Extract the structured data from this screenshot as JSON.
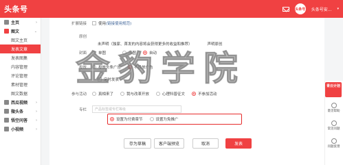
{
  "header": {
    "logo": "头条号",
    "avatar_text": "头条号",
    "user_name": "头条号安...",
    "caret": "▾"
  },
  "sidebar": {
    "items": [
      {
        "label": "主页",
        "type": "main",
        "caret": "›"
      },
      {
        "label": "图文",
        "type": "main",
        "caret": "⌄"
      },
      {
        "label": "图文主页",
        "type": "sub"
      },
      {
        "label": "发表文章",
        "type": "sub",
        "active": true
      },
      {
        "label": "发表图集",
        "type": "sub"
      },
      {
        "label": "内容管理",
        "type": "sub"
      },
      {
        "label": "评论管理",
        "type": "sub"
      },
      {
        "label": "素材管理",
        "type": "sub"
      },
      {
        "label": "图文数据",
        "type": "sub"
      },
      {
        "label": "西瓜视频",
        "type": "main",
        "caret": "›"
      },
      {
        "label": "微头条",
        "type": "main",
        "caret": "›"
      },
      {
        "label": "悟空问答",
        "type": "main",
        "caret": "›"
      },
      {
        "label": "小视频",
        "type": "main",
        "caret": "›"
      }
    ]
  },
  "form": {
    "extend_link": {
      "label": "扩展链接",
      "option": "使用",
      "link": "(链接使用规范)"
    },
    "original": {
      "label": "原创",
      "opt1": "未声明（独家、首发的内容将会获得更多的收益和推荐）",
      "opt2": "声明原创"
    },
    "cover": {
      "label": "封面",
      "opt1": "单图",
      "opt2": "三图",
      "opt3": "自动"
    },
    "ad": {
      "label": "投放",
      "opt1": "投放头条广告",
      "opt2": "不投放广告",
      "opt3": "定时发表"
    },
    "activity": {
      "label": "参与活动",
      "opt1": "真相来了",
      "opt2": "我与改革开放",
      "opt3": "心理科普征文",
      "opt4": "不参加活动"
    },
    "column": {
      "label": "专栏",
      "placeholder": "产品标签或专栏等级",
      "opt_paid": "设置为付费章节",
      "opt_free": "设置为免推广"
    }
  },
  "buttons": {
    "save_draft": "存为草稿",
    "preview": "客户端预览",
    "cancel": "取消",
    "publish": "发表"
  },
  "rightbar": {
    "promo": "青云计划",
    "items": [
      "意见帮助",
      "常见问题",
      "问题反馈"
    ]
  },
  "watermark": "金豹学院",
  "colors": {
    "brand": "#f04142",
    "link": "#406599"
  }
}
